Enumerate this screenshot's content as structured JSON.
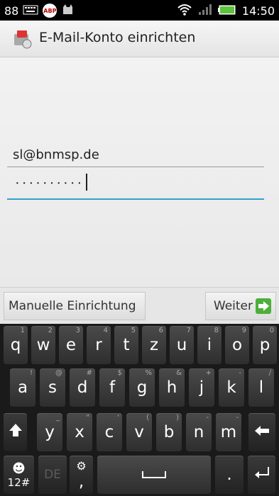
{
  "status": {
    "left_number": "88",
    "abp": "ABP",
    "time": "14:50"
  },
  "actionbar": {
    "title": "E-Mail-Konto einrichten"
  },
  "form": {
    "email_value": "sl@bnmsp.de",
    "password_dots": "••••••••••"
  },
  "buttons": {
    "manual": "Manuelle Einrichtung",
    "next": "Weiter"
  },
  "keyboard": {
    "row1": [
      {
        "k": "q",
        "h": "1"
      },
      {
        "k": "w",
        "h": "2"
      },
      {
        "k": "e",
        "h": "3"
      },
      {
        "k": "r",
        "h": "4"
      },
      {
        "k": "t",
        "h": "5"
      },
      {
        "k": "z",
        "h": "6"
      },
      {
        "k": "u",
        "h": "7"
      },
      {
        "k": "i",
        "h": "8"
      },
      {
        "k": "o",
        "h": "9"
      },
      {
        "k": "p",
        "h": "0"
      }
    ],
    "row2": [
      {
        "k": "a",
        "h": "!"
      },
      {
        "k": "s",
        "h": "@"
      },
      {
        "k": "d",
        "h": "#"
      },
      {
        "k": "f",
        "h": "$"
      },
      {
        "k": "g",
        "h": "%"
      },
      {
        "k": "h",
        "h": "&"
      },
      {
        "k": "j",
        "h": "+"
      },
      {
        "k": "k",
        "h": "-"
      },
      {
        "k": "l",
        "h": "/"
      }
    ],
    "row3": [
      {
        "k": "y",
        "h": "_"
      },
      {
        "k": "x",
        "h": "\""
      },
      {
        "k": "c",
        "h": "'"
      },
      {
        "k": "v",
        "h": "("
      },
      {
        "k": "b",
        "h": ")"
      },
      {
        "k": "n",
        "h": "-"
      },
      {
        "k": "m",
        "h": "-"
      }
    ],
    "num_key": "12#",
    "lang_key": "DE",
    "comma_key": ",",
    "period_key": "."
  }
}
